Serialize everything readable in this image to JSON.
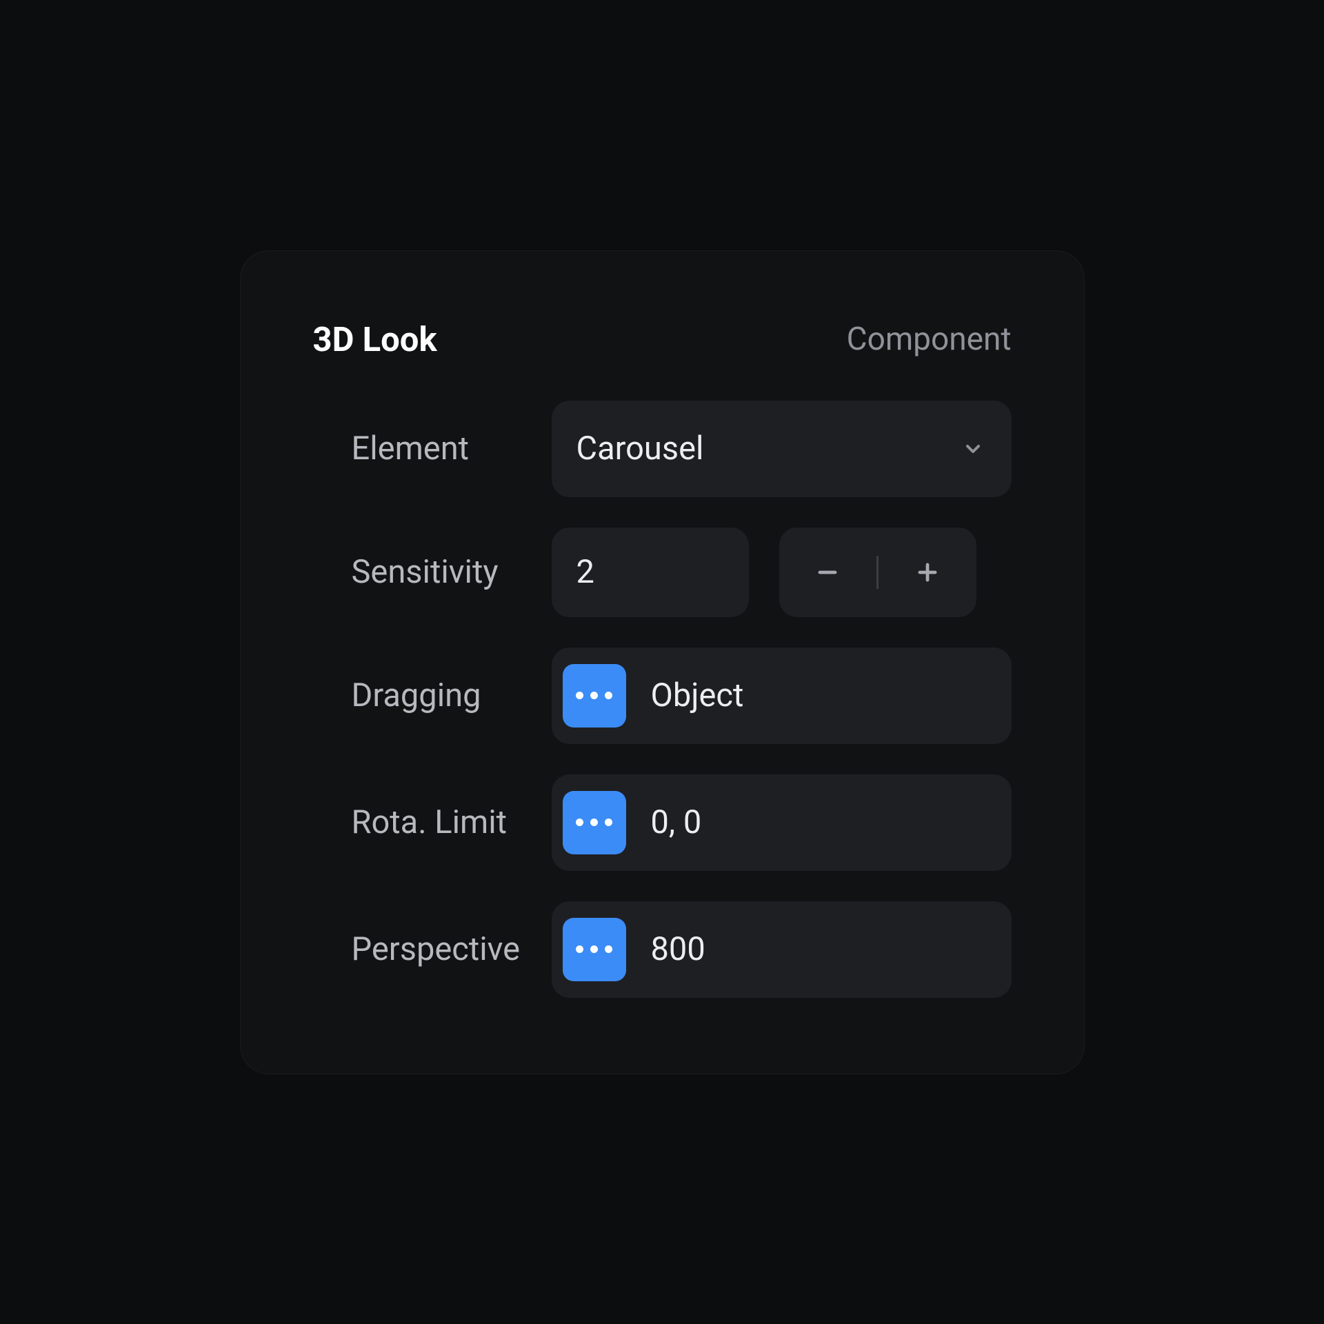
{
  "header": {
    "title": "3D Look",
    "meta": "Component"
  },
  "fields": {
    "element": {
      "label": "Element",
      "value": "Carousel"
    },
    "sensitivity": {
      "label": "Sensitivity",
      "value": "2"
    },
    "dragging": {
      "label": "Dragging",
      "value": "Object"
    },
    "rota_limit": {
      "label": "Rota. Limit",
      "value": "0, 0"
    },
    "perspective": {
      "label": "Perspective",
      "value": "800"
    }
  },
  "colors": {
    "accent": "#3b8cf6",
    "panel_bg": "#111214",
    "control_bg": "#1e1f23",
    "page_bg": "#0c0d0e"
  }
}
